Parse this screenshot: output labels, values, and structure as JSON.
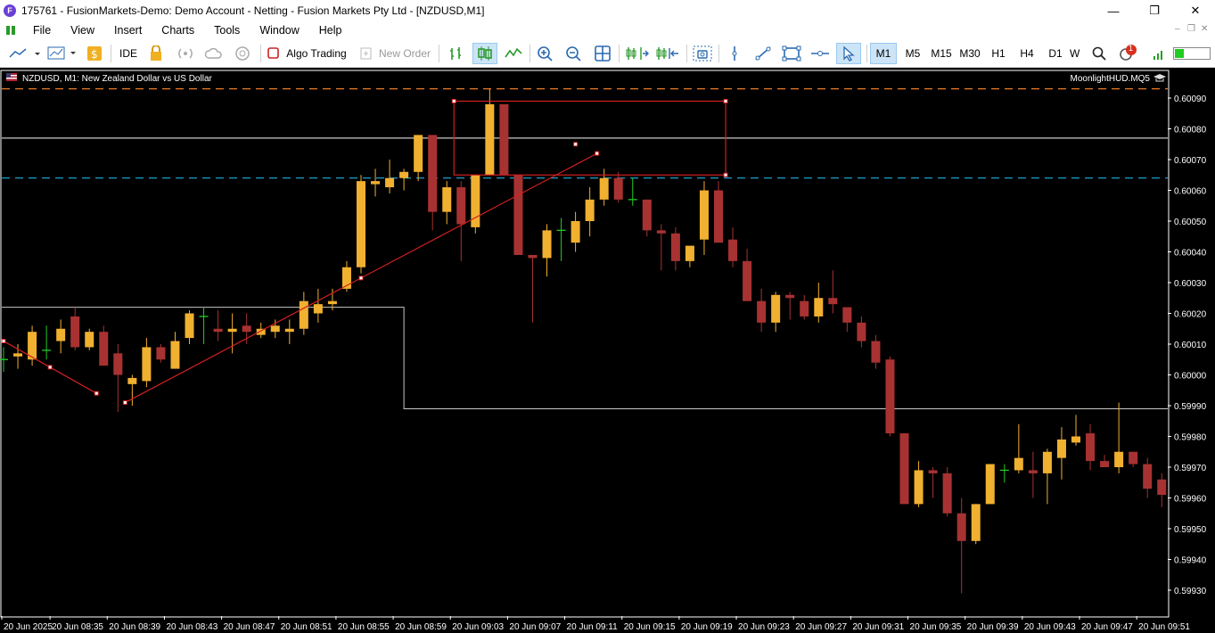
{
  "window": {
    "title": "175761 - FusionMarkets-Demo: Demo Account - Netting - Fusion Markets Pty Ltd - [NZDUSD,M1]",
    "app_icon_letter": "F",
    "minimize": "—",
    "restore": "❐",
    "close": "✕"
  },
  "menu": [
    "File",
    "View",
    "Insert",
    "Charts",
    "Tools",
    "Window",
    "Help"
  ],
  "mdi_controls": [
    "–",
    "❐",
    "✕"
  ],
  "toolbar": {
    "ide_label": "IDE",
    "algo_trading_label": "Algo Trading",
    "new_order_label": "New Order",
    "timeframes": [
      "M1",
      "M5",
      "M15",
      "M30",
      "H1",
      "H4",
      "D1",
      "W"
    ],
    "active_timeframe": "M1",
    "notification_count": "1",
    "icons": [
      "new-chart-icon",
      "chart-template-icon",
      "market-icon",
      "strategy-tester-icon",
      "signals-icon",
      "cloud-icon",
      "vps-icon",
      "bar-chart-icon",
      "candlestick-chart-icon",
      "line-chart-icon",
      "zoom-in-icon",
      "zoom-out-icon",
      "tile-windows-icon",
      "chart-shift-icon",
      "autoscroll-icon",
      "screenshot-icon",
      "vertical-line-icon",
      "trendline-icon",
      "rectangle-icon",
      "horizontal-line-icon",
      "cursor-icon",
      "search-icon",
      "notifications-icon",
      "signal-strength-icon",
      "progress-bar"
    ]
  },
  "chart": {
    "symbol_label": "NZDUSD, M1:  New Zealand Dollar vs US Dollar",
    "indicator_label": "MoonlightHUD.MQ5",
    "price_ticks": [
      "0.60090",
      "0.60080",
      "0.60070",
      "0.60060",
      "0.60050",
      "0.60040",
      "0.60030",
      "0.60020",
      "0.60010",
      "0.60000",
      "0.59990",
      "0.59980",
      "0.59970",
      "0.59960",
      "0.59950",
      "0.59940",
      "0.59930"
    ],
    "time_ticks": [
      "20 Jun 2025",
      "20 Jun 08:35",
      "20 Jun 08:39",
      "20 Jun 08:43",
      "20 Jun 08:47",
      "20 Jun 08:51",
      "20 Jun 08:55",
      "20 Jun 08:59",
      "20 Jun 09:03",
      "20 Jun 09:07",
      "20 Jun 09:11",
      "20 Jun 09:15",
      "20 Jun 09:19",
      "20 Jun 09:23",
      "20 Jun 09:27",
      "20 Jun 09:31",
      "20 Jun 09:35",
      "20 Jun 09:39",
      "20 Jun 09:43",
      "20 Jun 09:47",
      "20 Jun 09:51"
    ],
    "colors": {
      "background": "#000000",
      "bull": "#f0b030",
      "bear": "#a83232",
      "doji": "#22cc22",
      "grid_text": "#ffffff",
      "hline_orange": "#e87a2a",
      "hline_cyan": "#1fb0e0",
      "drawing_red": "#d02020"
    }
  },
  "chart_data": {
    "type": "candlestick",
    "symbol": "NZDUSD",
    "timeframe": "M1",
    "ylim": [
      0.59925,
      0.60095
    ],
    "x_start": "20 Jun 08:32",
    "x_step_minutes": 1,
    "ohlc": [
      [
        0.60005,
        0.60009,
        0.60001,
        0.60005
      ],
      [
        0.60006,
        0.6001,
        0.60002,
        0.60007
      ],
      [
        0.60005,
        0.60016,
        0.60003,
        0.60014
      ],
      [
        0.60008,
        0.60016,
        0.60005,
        0.60008
      ],
      [
        0.60011,
        0.60018,
        0.60007,
        0.60015
      ],
      [
        0.60019,
        0.60022,
        0.60008,
        0.60009
      ],
      [
        0.60009,
        0.60015,
        0.60008,
        0.60014
      ],
      [
        0.60014,
        0.60016,
        0.60003,
        0.60003
      ],
      [
        0.60007,
        0.6001,
        0.59988,
        0.6
      ],
      [
        0.59997,
        0.6,
        0.5999,
        0.59999
      ],
      [
        0.59998,
        0.60012,
        0.59996,
        0.60009
      ],
      [
        0.60009,
        0.6001,
        0.60004,
        0.60005
      ],
      [
        0.60002,
        0.60014,
        0.60002,
        0.60011
      ],
      [
        0.60012,
        0.60021,
        0.6001,
        0.6002
      ],
      [
        0.60019,
        0.60022,
        0.6001,
        0.60019
      ],
      [
        0.60015,
        0.60021,
        0.60011,
        0.60014
      ],
      [
        0.60014,
        0.6002,
        0.60007,
        0.60015
      ],
      [
        0.60016,
        0.6002,
        0.6001,
        0.60014
      ],
      [
        0.60013,
        0.60017,
        0.60012,
        0.60015
      ],
      [
        0.60014,
        0.60018,
        0.60012,
        0.60016
      ],
      [
        0.60014,
        0.60018,
        0.6001,
        0.60015
      ],
      [
        0.60015,
        0.60027,
        0.60013,
        0.60024
      ],
      [
        0.6002,
        0.60028,
        0.60017,
        0.60023
      ],
      [
        0.60023,
        0.60028,
        0.60021,
        0.60024
      ],
      [
        0.60028,
        0.60037,
        0.60027,
        0.60035
      ],
      [
        0.60035,
        0.60065,
        0.60033,
        0.60063
      ],
      [
        0.60062,
        0.60067,
        0.60058,
        0.60063
      ],
      [
        0.60061,
        0.6007,
        0.60059,
        0.60064
      ],
      [
        0.60064,
        0.60067,
        0.6006,
        0.60066
      ],
      [
        0.60066,
        0.60078,
        0.60063,
        0.60078
      ],
      [
        0.60078,
        0.60078,
        0.60047,
        0.60053
      ],
      [
        0.60053,
        0.60063,
        0.60049,
        0.60061
      ],
      [
        0.60061,
        0.60063,
        0.60037,
        0.60049
      ],
      [
        0.60048,
        0.60065,
        0.60046,
        0.60065
      ],
      [
        0.60065,
        0.60093,
        0.60065,
        0.60088
      ],
      [
        0.60088,
        0.60088,
        0.60065,
        0.60065
      ],
      [
        0.60065,
        0.60065,
        0.60039,
        0.60039
      ],
      [
        0.60039,
        0.60039,
        0.60017,
        0.60038
      ],
      [
        0.60038,
        0.60049,
        0.60032,
        0.60047
      ],
      [
        0.60047,
        0.60051,
        0.60037,
        0.60047
      ],
      [
        0.60043,
        0.60053,
        0.6004,
        0.6005
      ],
      [
        0.6005,
        0.60061,
        0.60045,
        0.60057
      ],
      [
        0.60057,
        0.60067,
        0.60055,
        0.60064
      ],
      [
        0.60064,
        0.60066,
        0.60056,
        0.60057
      ],
      [
        0.60057,
        0.60064,
        0.60055,
        0.60057
      ],
      [
        0.60057,
        0.60057,
        0.60045,
        0.60047
      ],
      [
        0.60047,
        0.60049,
        0.60034,
        0.60046
      ],
      [
        0.60046,
        0.60048,
        0.60034,
        0.60037
      ],
      [
        0.60037,
        0.60041,
        0.60035,
        0.60042
      ],
      [
        0.60044,
        0.60063,
        0.60039,
        0.6006
      ],
      [
        0.6006,
        0.60063,
        0.60043,
        0.60043
      ],
      [
        0.60044,
        0.60048,
        0.60035,
        0.60037
      ],
      [
        0.60037,
        0.60041,
        0.60024,
        0.60024
      ],
      [
        0.60024,
        0.60028,
        0.60014,
        0.60017
      ],
      [
        0.60017,
        0.60027,
        0.60014,
        0.60026
      ],
      [
        0.60026,
        0.60027,
        0.60018,
        0.60025
      ],
      [
        0.60024,
        0.60026,
        0.60018,
        0.60019
      ],
      [
        0.60019,
        0.6003,
        0.60017,
        0.60025
      ],
      [
        0.60025,
        0.60034,
        0.6002,
        0.60023
      ],
      [
        0.60022,
        0.60022,
        0.60014,
        0.60017
      ],
      [
        0.60017,
        0.60019,
        0.60009,
        0.60011
      ],
      [
        0.60011,
        0.60013,
        0.60002,
        0.60004
      ],
      [
        0.60005,
        0.60006,
        0.5998,
        0.59981
      ],
      [
        0.59981,
        0.59981,
        0.59959,
        0.59958
      ],
      [
        0.59958,
        0.59972,
        0.59957,
        0.59969
      ],
      [
        0.59969,
        0.5997,
        0.5996,
        0.59968
      ],
      [
        0.59968,
        0.5997,
        0.59954,
        0.59955
      ],
      [
        0.59955,
        0.5996,
        0.59929,
        0.59946
      ],
      [
        0.59946,
        0.59958,
        0.59945,
        0.59958
      ],
      [
        0.59958,
        0.59971,
        0.59958,
        0.59971
      ],
      [
        0.59969,
        0.59971,
        0.59965,
        0.59969
      ],
      [
        0.59969,
        0.59984,
        0.59968,
        0.59973
      ],
      [
        0.59969,
        0.59975,
        0.5996,
        0.59968
      ],
      [
        0.59968,
        0.59976,
        0.59958,
        0.59975
      ],
      [
        0.59973,
        0.59983,
        0.59966,
        0.59979
      ],
      [
        0.59978,
        0.59987,
        0.59977,
        0.5998
      ],
      [
        0.59981,
        0.59984,
        0.59969,
        0.59972
      ],
      [
        0.59972,
        0.59974,
        0.59971,
        0.5997
      ],
      [
        0.5997,
        0.59991,
        0.59968,
        0.59975
      ],
      [
        0.59975,
        0.59975,
        0.5997,
        0.59971
      ],
      [
        0.59971,
        0.59973,
        0.5996,
        0.59963
      ],
      [
        0.59966,
        0.59968,
        0.59957,
        0.59961
      ],
      [
        0.59961,
        0.59963,
        0.5995,
        0.59962
      ],
      [
        0.59961,
        0.59966,
        0.59955,
        0.59965
      ]
    ],
    "horizontal_lines": [
      {
        "price": 0.60093,
        "style": "dashed",
        "color": "#e87a2a"
      },
      {
        "price": 0.60077,
        "style": "solid",
        "color": "#c8c8c8"
      },
      {
        "price": 0.60064,
        "style": "dashed",
        "color": "#1fb0e0"
      }
    ],
    "drawings": [
      {
        "kind": "trendline",
        "points": [
          [
            0,
            0.60011
          ],
          [
            6.5,
            0.59994
          ]
        ]
      },
      {
        "kind": "trendline",
        "points": [
          [
            8.5,
            0.59991
          ],
          [
            41.5,
            0.60072
          ]
        ]
      },
      {
        "kind": "rectangle",
        "x0": 31.5,
        "x1": 50.5,
        "p0": 0.60089,
        "p1": 0.60065
      },
      {
        "kind": "point",
        "x": 40,
        "price": 0.60075
      },
      {
        "kind": "box",
        "x0": -1,
        "x1": 28,
        "x2": 83,
        "p0": 0.60022,
        "p1": 0.59989
      }
    ]
  }
}
